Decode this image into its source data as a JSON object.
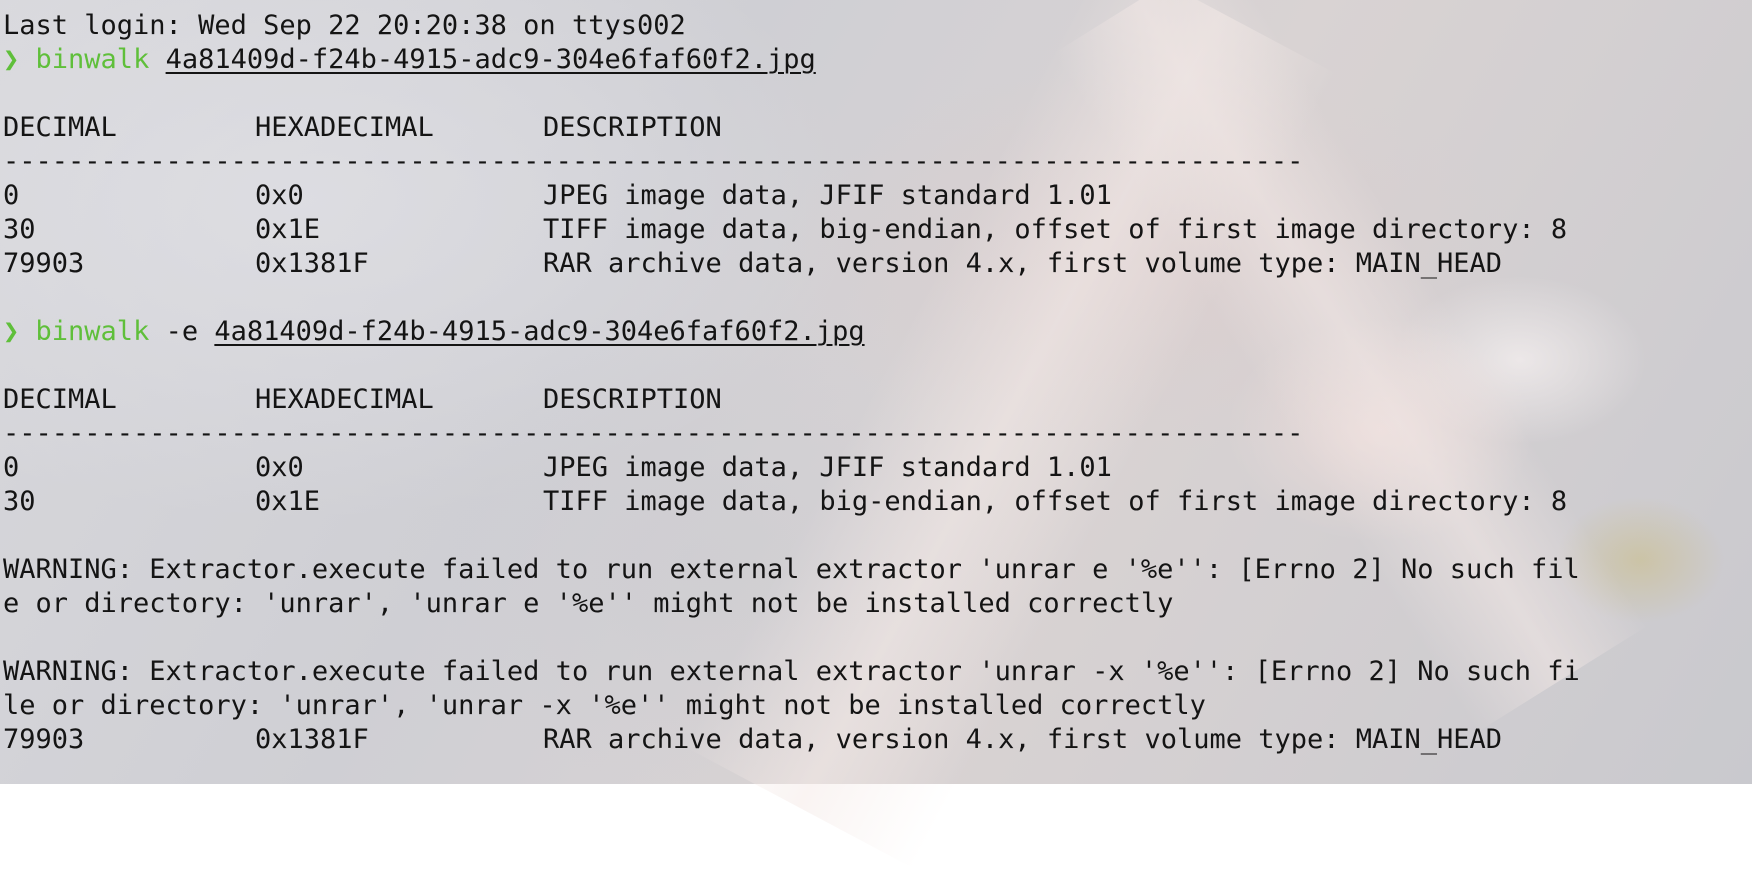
{
  "terminal": {
    "last_login": "Last login: Wed Sep 22 20:20:38 on ttys002",
    "prompt_symbol": "❯",
    "commands": [
      {
        "program": "binwalk",
        "args": "",
        "file": "4a81409d-f24b-4915-adc9-304e6faf60f2.jpg"
      },
      {
        "program": "binwalk",
        "args": " -e ",
        "file": "4a81409d-f24b-4915-adc9-304e6faf60f2.jpg"
      }
    ],
    "headers": {
      "decimal": "DECIMAL",
      "hexadecimal": "HEXADECIMAL",
      "description": "DESCRIPTION"
    },
    "divider": "--------------------------------------------------------------------------------",
    "scan1_rows": [
      {
        "decimal": "0",
        "hex": "0x0",
        "description": "JPEG image data, JFIF standard 1.01"
      },
      {
        "decimal": "30",
        "hex": "0x1E",
        "description": "TIFF image data, big-endian, offset of first image directory: 8"
      },
      {
        "decimal": "79903",
        "hex": "0x1381F",
        "description": "RAR archive data, version 4.x, first volume type: MAIN_HEAD"
      }
    ],
    "scan2_rows": [
      {
        "decimal": "0",
        "hex": "0x0",
        "description": "JPEG image data, JFIF standard 1.01"
      },
      {
        "decimal": "30",
        "hex": "0x1E",
        "description": "TIFF image data, big-endian, offset of first image directory: 8"
      }
    ],
    "warnings": [
      {
        "line1": "WARNING: Extractor.execute failed to run external extractor 'unrar e '%e'': [Errno 2] No such fil",
        "line2": "e or directory: 'unrar', 'unrar e '%e'' might not be installed correctly"
      },
      {
        "line1": "WARNING: Extractor.execute failed to run external extractor 'unrar -x '%e'': [Errno 2] No such fi",
        "line2": "le or directory: 'unrar', 'unrar -x '%e'' might not be installed correctly"
      }
    ],
    "scan2_last_row": {
      "decimal": "79903",
      "hex": "0x1381F",
      "description": "RAR archive data, version 4.x, first volume type: MAIN_HEAD"
    }
  },
  "colors": {
    "prompt_green": "#5fbf3a",
    "text": "#141414"
  }
}
